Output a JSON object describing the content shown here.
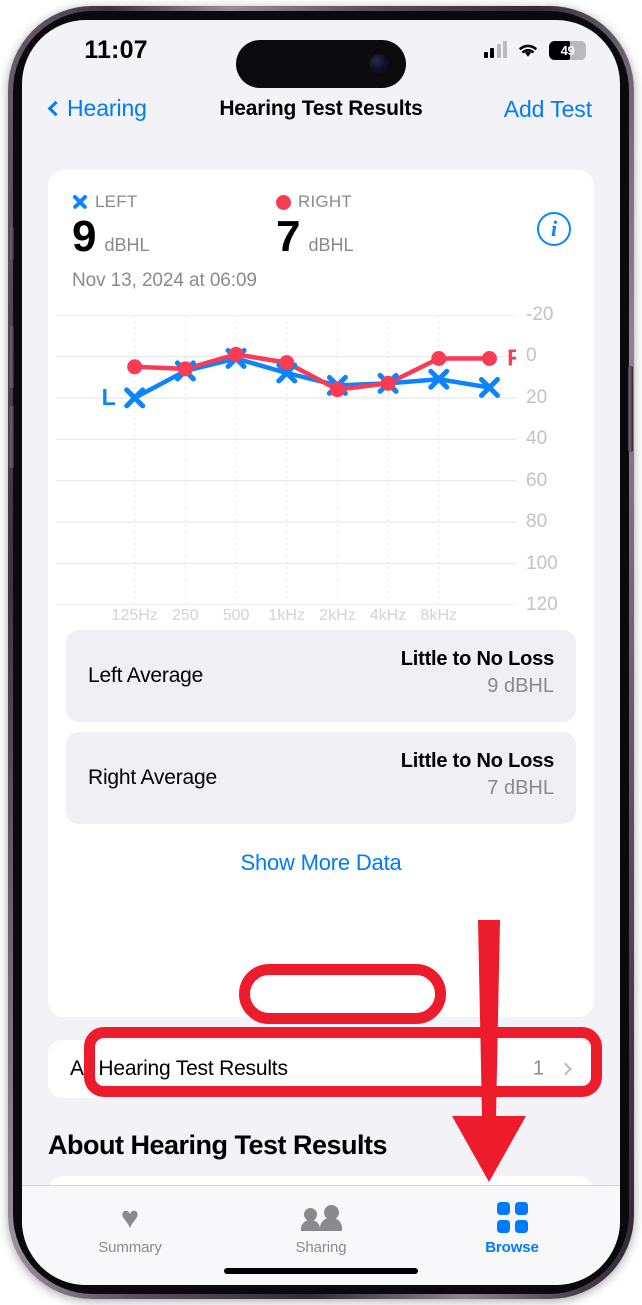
{
  "status_bar": {
    "time": "11:07",
    "battery_percent": "49",
    "cellular_icon": "cellular-bars-icon",
    "wifi_icon": "wifi-icon",
    "battery_icon": "battery-icon"
  },
  "nav": {
    "back_label": "Hearing",
    "back_icon": "chevron-left-icon",
    "title": "Hearing Test Results",
    "action_label": "Add Test"
  },
  "summary": {
    "left": {
      "legend": "LEFT",
      "marker_icon": "x-marker-icon",
      "value": "9",
      "unit": "dBHL"
    },
    "right": {
      "legend": "RIGHT",
      "marker_icon": "dot-marker-icon",
      "value": "7",
      "unit": "dBHL"
    },
    "date": "Nov 13, 2024 at 06:09",
    "info_icon": "info-circle-icon",
    "info_glyph": "i"
  },
  "chart_data": {
    "type": "line",
    "title": "",
    "xlabel": "",
    "ylabel": "",
    "categories": [
      "125Hz",
      "250",
      "500",
      "1kHz",
      "2kHz",
      "4kHz",
      "8kHz"
    ],
    "x_tick_labels": [
      "125Hz",
      "250",
      "500",
      "1kHz",
      "2kHz",
      "4kHz",
      "8kHz"
    ],
    "y_tick_labels": [
      "-20",
      "0",
      "20",
      "40",
      "60",
      "80",
      "100",
      "120"
    ],
    "ylim": [
      -20,
      120
    ],
    "y_inverted": true,
    "grid": true,
    "legend_position": "inline-series-labels",
    "x_positions": [
      0,
      1,
      2,
      3,
      4,
      5,
      6,
      7
    ],
    "series": [
      {
        "name": "L",
        "label": "L",
        "color": "#0a84ff",
        "marker": "x",
        "values": [
          20,
          7,
          1,
          8,
          14,
          13,
          11,
          15
        ]
      },
      {
        "name": "R",
        "label": "R",
        "color": "#fb3b53",
        "marker": "circle",
        "values": [
          5,
          6,
          -1,
          3,
          16,
          13,
          1,
          1
        ]
      }
    ]
  },
  "averages": [
    {
      "name": "Left Average",
      "status": "Little to No Loss",
      "value": "9 dBHL"
    },
    {
      "name": "Right Average",
      "status": "Little to No Loss",
      "value": "7 dBHL"
    }
  ],
  "show_more_label": "Show More Data",
  "all_results": {
    "label": "All Hearing Test Results",
    "count": "1",
    "chevron_icon": "chevron-right-icon"
  },
  "about_title": "About Hearing Test Results",
  "tabs": [
    {
      "label": "Summary",
      "icon": "heart-icon",
      "active": false
    },
    {
      "label": "Sharing",
      "icon": "people-icon",
      "active": false
    },
    {
      "label": "Browse",
      "icon": "grid-icon",
      "active": true
    }
  ],
  "annotations": {
    "highlight_color": "#ec1c2d",
    "arrow_icon": "down-arrow-annotation"
  },
  "colors": {
    "accent_blue": "#007aff",
    "left_blue": "#0a84ff",
    "right_red": "#fb3b53",
    "annotation_red": "#ec1c2d"
  }
}
